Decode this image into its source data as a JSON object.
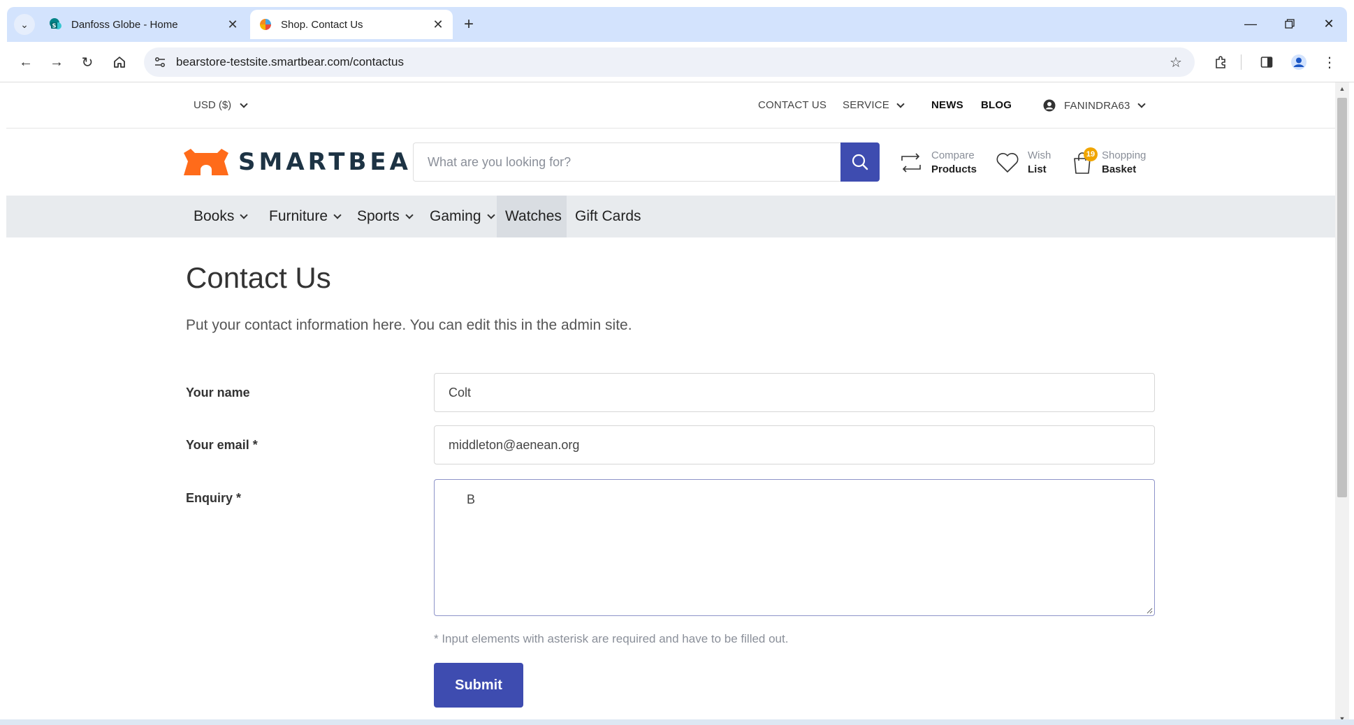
{
  "browser": {
    "tabs": [
      {
        "title": "Danfoss Globe - Home",
        "active": false
      },
      {
        "title": "Shop. Contact Us",
        "active": true
      }
    ],
    "url": "bearstore-testsite.smartbear.com/contactus"
  },
  "utility_bar": {
    "currency": "USD ($)",
    "links": [
      "CONTACT US",
      "SERVICE",
      "NEWS",
      "BLOG"
    ],
    "account": "FANINDRA63"
  },
  "header": {
    "logo_text": "SMARTBEAR",
    "search_placeholder": "What are you looking for?",
    "compare": {
      "top": "Compare",
      "bottom": "Products"
    },
    "wishlist": {
      "top": "Wish",
      "bottom": "List"
    },
    "basket": {
      "top": "Shopping",
      "bottom": "Basket",
      "count": "19"
    }
  },
  "nav": {
    "items": [
      "Books",
      "Furniture",
      "Sports",
      "Gaming",
      "Watches",
      "Gift Cards"
    ]
  },
  "page": {
    "title": "Contact Us",
    "intro": "Put your contact information here. You can edit this in the admin site.",
    "form": {
      "name_label": "Your name",
      "name_value": "Colt",
      "email_label": "Your email *",
      "email_value": "middleton@aenean.org",
      "enquiry_label": "Enquiry *",
      "enquiry_value": "B",
      "hint": "* Input elements with asterisk are required and have to be filled out.",
      "submit_label": "Submit"
    }
  },
  "colors": {
    "primary": "#3e4cb0",
    "brand_orange": "#ff6b1a",
    "nav_bg": "#e8ebee",
    "badge": "#f0a500"
  }
}
